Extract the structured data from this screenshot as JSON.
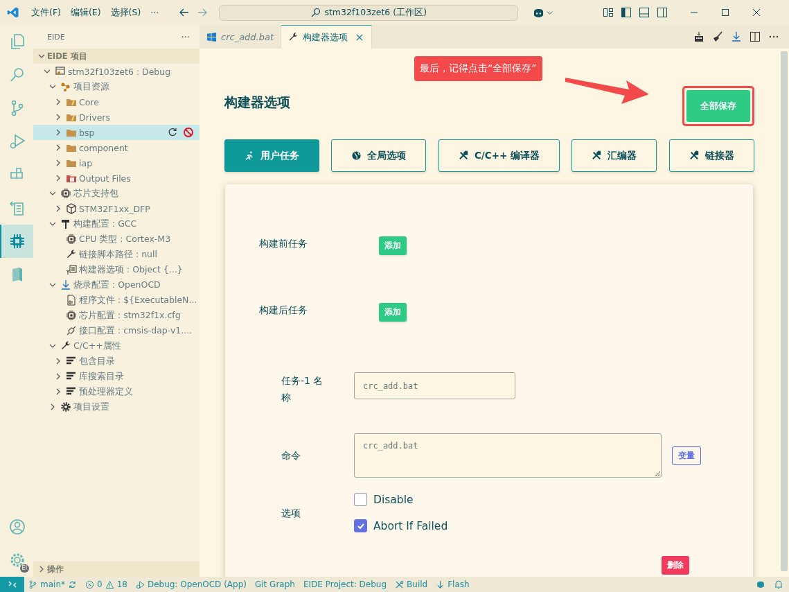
{
  "title_bar": {
    "menus": [
      "文件(F)",
      "编辑(E)",
      "选择(S)",
      "···"
    ],
    "search": "stm32f103zet6 (工作区)"
  },
  "activity_bar": {
    "items": [
      {
        "kind": "explorer",
        "selected": false
      },
      {
        "kind": "search",
        "selected": false
      },
      {
        "kind": "source-control",
        "selected": false
      },
      {
        "kind": "debug",
        "selected": false
      },
      {
        "kind": "extensions",
        "selected": false
      },
      {
        "kind": "remote",
        "selected": false
      },
      {
        "kind": "chip",
        "selected": true
      },
      {
        "kind": "book",
        "selected": false
      }
    ],
    "bottom": [
      {
        "kind": "account"
      },
      {
        "kind": "settings",
        "badge": "EI"
      }
    ]
  },
  "sidebar": {
    "title": "EIDE",
    "more": "···",
    "sections": [
      {
        "title": "EIDE 项目",
        "expanded": true,
        "children": [
          {
            "label": "stm32f103zet6 : Debug",
            "kind": "project",
            "expanded": true,
            "selected": false,
            "children": [
              {
                "label": "项目资源",
                "kind": "sources",
                "expanded": true,
                "selected": false,
                "children": [
                  {
                    "label": "Core",
                    "kind": "folder-src",
                    "expanded": false,
                    "selected": false
                  },
                  {
                    "label": "Drivers",
                    "kind": "folder-src",
                    "expanded": false,
                    "selected": false
                  },
                  {
                    "label": "bsp",
                    "kind": "folder",
                    "expanded": false,
                    "selected": true
                  },
                  {
                    "label": "component",
                    "kind": "folder",
                    "expanded": false,
                    "selected": false
                  },
                  {
                    "label": "iap",
                    "kind": "folder",
                    "expanded": false,
                    "selected": false
                  },
                  {
                    "label": "Output Files",
                    "kind": "folder-output",
                    "expanded": false,
                    "selected": false
                  }
                ]
              },
              {
                "label": "芯片支持包",
                "kind": "chip",
                "expanded": true,
                "selected": false,
                "children": [
                  {
                    "label": "STM32F1xx_DFP",
                    "kind": "package",
                    "expanded": false,
                    "selected": false
                  }
                ]
              },
              {
                "label": "构建配置 : GCC",
                "kind": "hammer",
                "expanded": true,
                "selected": false,
                "children": [
                  {
                    "label": "CPU 类型 : Cortex-M3",
                    "kind": "chip",
                    "selected": false
                  },
                  {
                    "label": "链接脚本路径 : null",
                    "kind": "wrench",
                    "selected": false
                  },
                  {
                    "label": "构建器选项 : Object {...}",
                    "kind": "config",
                    "selected": false
                  }
                ]
              },
              {
                "label": "烧录配置 : OpenOCD",
                "kind": "download",
                "expanded": true,
                "selected": false,
                "children": [
                  {
                    "label": "程序文件 : ${ExecutableN...",
                    "kind": "file",
                    "selected": false
                  },
                  {
                    "label": "芯片配置 : stm32f1x.cfg",
                    "kind": "chip",
                    "selected": false
                  },
                  {
                    "label": "接口配置 : cmsis-dap-v1....",
                    "kind": "plug",
                    "selected": false
                  }
                ]
              },
              {
                "label": "C/C++属性",
                "kind": "wrench",
                "expanded": true,
                "selected": false,
                "children": [
                  {
                    "label": "包含目录",
                    "kind": "list",
                    "expanded": false,
                    "selected": false
                  },
                  {
                    "label": "库搜索目录",
                    "kind": "list",
                    "expanded": false,
                    "selected": false
                  },
                  {
                    "label": "预处理器定义",
                    "kind": "list",
                    "expanded": false,
                    "selected": false
                  }
                ]
              },
              {
                "label": "项目设置",
                "kind": "gear",
                "expanded": false,
                "selected": false
              }
            ]
          }
        ]
      },
      {
        "title": "操作",
        "expanded": false
      }
    ]
  },
  "tabs": [
    {
      "label": "crc_add.bat",
      "kind": "windows",
      "preview": true,
      "selected": false
    },
    {
      "label": "构建器选项",
      "kind": "wrench",
      "preview": false,
      "selected": true
    }
  ],
  "editor": {
    "heading": "构建器选项",
    "save_button": "全部保存",
    "annotation": "最后，记得点击“全部保存”",
    "nav": [
      {
        "label": "用户任务",
        "kind": "run",
        "selected": true
      },
      {
        "label": "全局选项",
        "kind": "globe",
        "selected": false
      },
      {
        "label": "C/C++ 编译器",
        "kind": "tools",
        "selected": false
      },
      {
        "label": "汇编器",
        "kind": "tools",
        "selected": false
      },
      {
        "label": "链接器",
        "kind": "tools",
        "selected": false
      }
    ],
    "prebuild": {
      "label": "构建前任务",
      "button": "添加"
    },
    "postbuild": {
      "label": "构建后任务",
      "button": "添加"
    },
    "task": {
      "name_label": "任务-1 名称",
      "name_value": "crc_add.bat",
      "command_label": "命令",
      "command_value": "crc_add.bat",
      "vars_button": "变量",
      "options_label": "选项",
      "options": [
        {
          "label": "Disable",
          "checked": false
        },
        {
          "label": "Abort If Failed",
          "checked": true
        }
      ],
      "delete_button": "删除"
    }
  },
  "status_bar": {
    "branch": "main*",
    "errors": "0",
    "warnings": "18",
    "items": [
      {
        "kind": "debug",
        "label": "Debug: OpenOCD (App)"
      },
      {
        "kind": "plain",
        "label": "Git Graph"
      },
      {
        "kind": "plain",
        "label": "EIDE Project: Debug"
      },
      {
        "kind": "build",
        "label": "Build"
      },
      {
        "kind": "flash",
        "label": "Flash"
      }
    ]
  }
}
